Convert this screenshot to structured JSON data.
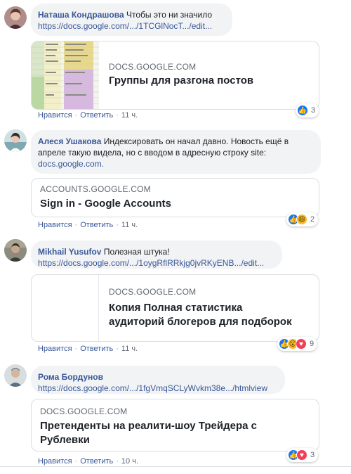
{
  "comments": [
    {
      "author": "Наташа Кондрашова",
      "text": "Чтобы это ни значило",
      "link": "https://docs.google.com/.../1TCGlNocT.../edit...",
      "card": {
        "domain": "DOCS.GOOGLE.COM",
        "title": "Группы для разгона постов"
      },
      "actions": {
        "like": "Нравится",
        "reply": "Ответить",
        "time": "11 ч."
      },
      "reactions": {
        "icons": [
          "like-icon"
        ],
        "count": "3"
      }
    },
    {
      "author": "Алеся Ушакова",
      "text": "Индексировать он начал давно. Новость ещё в апреле такую видела, но с вводом в адресную строку site:",
      "link": "docs.google.com.",
      "card": {
        "domain": "ACCOUNTS.GOOGLE.COM",
        "title": "Sign in - Google Accounts"
      },
      "actions": {
        "like": "Нравится",
        "reply": "Ответить",
        "time": "11 ч."
      },
      "reactions": {
        "icons": [
          "like-icon",
          "haha-icon"
        ],
        "count": "2"
      }
    },
    {
      "author": "Mikhail Yusufov",
      "text": "Полезная штука!",
      "link": "https://docs.google.com/.../1oygRflRRkjg0jvRKyENB.../edit...",
      "card": {
        "domain": "DOCS.GOOGLE.COM",
        "title_line1": "Копия Полная статистика",
        "title_line2": "аудиторий блогеров для подборок"
      },
      "actions": {
        "like": "Нравится",
        "reply": "Ответить",
        "time": "11 ч."
      },
      "reactions": {
        "icons": [
          "like-icon",
          "wow-icon",
          "love-icon"
        ],
        "count": "9"
      }
    },
    {
      "author": "Рома Бордунов",
      "text": "",
      "link": "https://docs.google.com/.../1fgVmqSCLyWvkm38e.../htmlview",
      "card": {
        "domain": "DOCS.GOOGLE.COM",
        "title_line1": "Претенденты на реалити-шоу Трейдера с",
        "title_line2": "Рублевки"
      },
      "actions": {
        "like": "Нравится",
        "reply": "Ответить",
        "time": "10 ч."
      },
      "reactions": {
        "icons": [
          "like-icon",
          "love-icon"
        ],
        "count": "3"
      }
    }
  ],
  "colors": {
    "author": "#385898",
    "bubble": "#f2f3f5",
    "like": "#1877f2",
    "love": "#f33e58",
    "haha": "#f7b928"
  }
}
